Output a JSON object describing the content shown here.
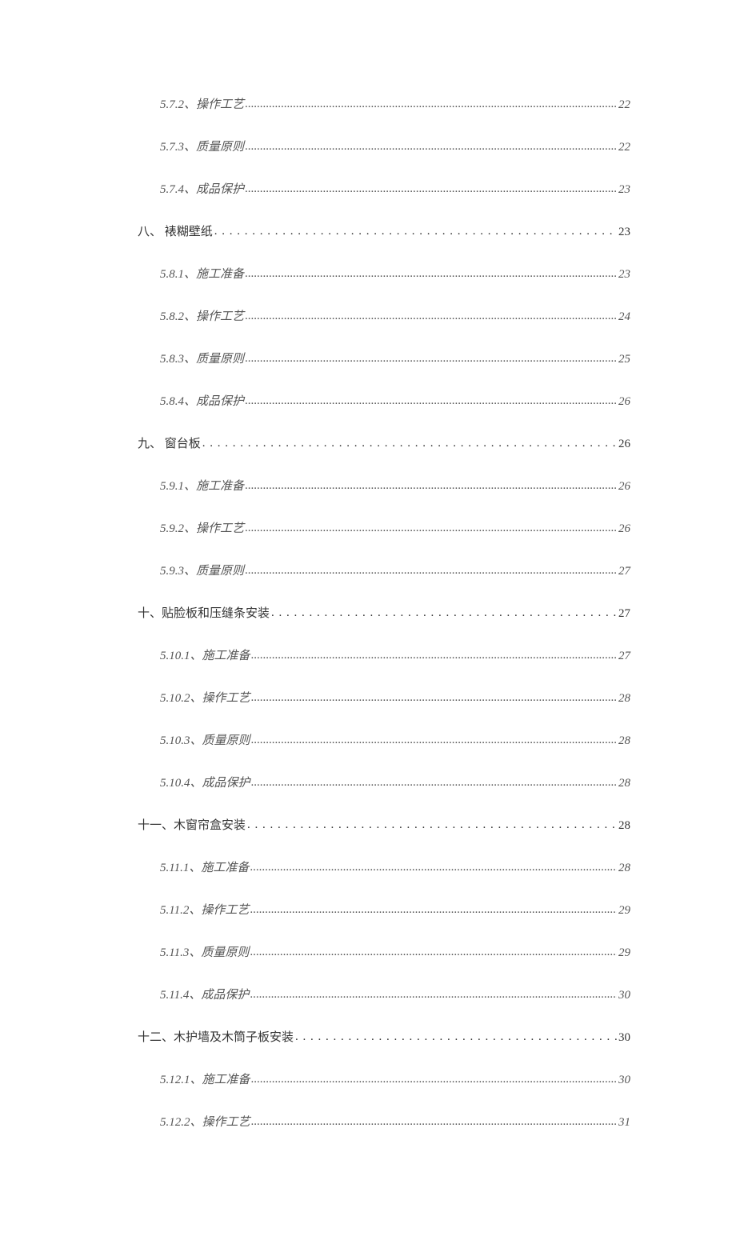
{
  "toc": [
    {
      "level": 2,
      "label": "5.7.2、操作工艺",
      "page": "22"
    },
    {
      "level": 2,
      "label": "5.7.3、质量原则",
      "page": "22"
    },
    {
      "level": 2,
      "label": "5.7.4、成品保护",
      "page": "23"
    },
    {
      "level": 1,
      "label": "八、 裱糊壁纸",
      "page": "23"
    },
    {
      "level": 2,
      "label": "5.8.1、施工准备",
      "page": "23"
    },
    {
      "level": 2,
      "label": "5.8.2、操作工艺",
      "page": "24"
    },
    {
      "level": 2,
      "label": "5.8.3、质量原则",
      "page": "25"
    },
    {
      "level": 2,
      "label": "5.8.4、成品保护",
      "page": "26"
    },
    {
      "level": 1,
      "label": "九、 窗台板",
      "page": "26"
    },
    {
      "level": 2,
      "label": "5.9.1、施工准备",
      "page": "26"
    },
    {
      "level": 2,
      "label": "5.9.2、操作工艺",
      "page": "26"
    },
    {
      "level": 2,
      "label": "5.9.3、质量原则",
      "page": "27"
    },
    {
      "level": 1,
      "label": "十、贴脸板和压缝条安装 ",
      "page": "27"
    },
    {
      "level": 2,
      "label": "5.10.1、施工准备",
      "page": "27"
    },
    {
      "level": 2,
      "label": "5.10.2、操作工艺",
      "page": "28"
    },
    {
      "level": 2,
      "label": "5.10.3、质量原则",
      "page": "28"
    },
    {
      "level": 2,
      "label": "5.10.4、成品保护",
      "page": "28"
    },
    {
      "level": 1,
      "label": "十一、木窗帘盒安装 ",
      "page": "28"
    },
    {
      "level": 2,
      "label": "5.11.1、施工准备",
      "page": "28"
    },
    {
      "level": 2,
      "label": "5.11.2、操作工艺",
      "page": "29"
    },
    {
      "level": 2,
      "label": "5.11.3、质量原则",
      "page": "29"
    },
    {
      "level": 2,
      "label": "5.11.4、成品保护",
      "page": "30"
    },
    {
      "level": 1,
      "label": "十二、木护墙及木筒子板安装 ",
      "page": "30"
    },
    {
      "level": 2,
      "label": "5.12.1、施工准备",
      "page": "30"
    },
    {
      "level": 2,
      "label": "5.12.2、操作工艺",
      "page": "31"
    }
  ]
}
